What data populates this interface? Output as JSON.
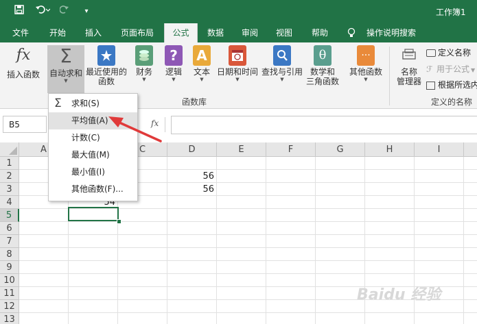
{
  "titlebar": {
    "doc_title": "工作簿1"
  },
  "tabs": [
    {
      "label": "文件"
    },
    {
      "label": "开始"
    },
    {
      "label": "插入"
    },
    {
      "label": "页面布局"
    },
    {
      "label": "公式"
    },
    {
      "label": "数据"
    },
    {
      "label": "审阅"
    },
    {
      "label": "视图"
    },
    {
      "label": "帮助"
    }
  ],
  "tellme": {
    "label": "操作说明搜索"
  },
  "ribbon": {
    "insert_function": "插入函数",
    "autosum": "自动求和",
    "recent_l1": "最近使用的",
    "recent_l2": "函数",
    "financial": "财务",
    "logical": "逻辑",
    "text": "文本",
    "datetime": "日期和时间",
    "lookup": "查找与引用",
    "math_l1": "数学和",
    "math_l2": "三角函数",
    "more": "其他函数",
    "name_mgr_l1": "名称",
    "name_mgr_l2": "管理器",
    "define_name": "定义名称",
    "use_in_formula": "用于公式",
    "create_from_sel": "根据所选内",
    "group_library": "函数库",
    "group_names": "定义的名称",
    "icon_fx": "fx",
    "icon_sigma": "Σ",
    "icon_q": "?",
    "icon_a": "A",
    "icon_theta": "θ",
    "icon_dots": "···"
  },
  "formula_bar": {
    "name_box": "B5",
    "fx": "fx",
    "formula": ""
  },
  "columns": [
    "A",
    "B",
    "C",
    "D",
    "E",
    "F",
    "G",
    "H",
    "I"
  ],
  "rows": [
    "1",
    "2",
    "3",
    "4",
    "5",
    "6",
    "7",
    "8",
    "9",
    "10",
    "11",
    "12",
    "13"
  ],
  "cells": {
    "D2": "56",
    "D3": "56",
    "C4": "54"
  },
  "menu": {
    "items": [
      {
        "label": "求和(S)"
      },
      {
        "label": "平均值(A)"
      },
      {
        "label": "计数(C)"
      },
      {
        "label": "最大值(M)"
      },
      {
        "label": "最小值(I)"
      },
      {
        "label": "其他函数(F)..."
      }
    ],
    "sigma": "Σ"
  },
  "watermark": "Baidu 经验",
  "colors": {
    "accent": "#217346",
    "arrow": "#e03a3a"
  }
}
